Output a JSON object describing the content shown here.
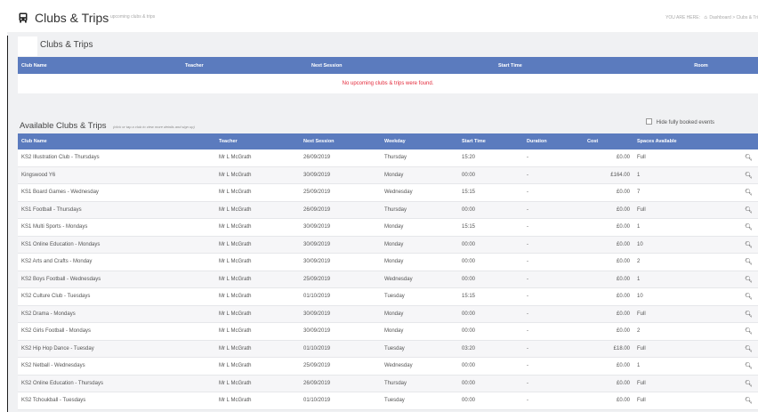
{
  "header": {
    "title": "Clubs & Trips",
    "subtitle": "upcoming clubs & trips",
    "breadcrumb": {
      "prefix": "YOU ARE HERE:",
      "home": "Dashboard",
      "separator": ">",
      "current": "Clubs & Tri"
    }
  },
  "upcoming": {
    "title": "Clubs & Trips",
    "columns": [
      "Club Name",
      "Teacher",
      "Next Session",
      "Start Time",
      "Room"
    ],
    "empty_message": "No upcoming clubs & trips were found."
  },
  "available": {
    "title": "Available Clubs & Trips",
    "hint": "(click or tap a club to view more details and sign up)",
    "hide_booked_label": "Hide fully booked events",
    "columns": [
      "Club Name",
      "Teacher",
      "Next Session",
      "Weekday",
      "Start Time",
      "Duration",
      "Cost",
      "Spaces Available"
    ],
    "rows": [
      {
        "club": "KS2 Illustration Club - Thursdays",
        "teacher": "Mr L McGrath",
        "next": "26/09/2019",
        "weekday": "Thursday",
        "start": "15:20",
        "duration": "-",
        "cost": "£0.00",
        "spaces": "Full"
      },
      {
        "club": "Kingswood Y6",
        "teacher": "Mr L McGrath",
        "next": "30/09/2019",
        "weekday": "Monday",
        "start": "00:00",
        "duration": "-",
        "cost": "£164.00",
        "spaces": "1"
      },
      {
        "club": "KS1 Board Games - Wednesday",
        "teacher": "Mr L McGrath",
        "next": "25/09/2019",
        "weekday": "Wednesday",
        "start": "15:15",
        "duration": "-",
        "cost": "£0.00",
        "spaces": "7"
      },
      {
        "club": "KS1 Football - Thursdays",
        "teacher": "Mr L McGrath",
        "next": "26/09/2019",
        "weekday": "Thursday",
        "start": "00:00",
        "duration": "-",
        "cost": "£0.00",
        "spaces": "Full"
      },
      {
        "club": "KS1 Multi Sports - Mondays",
        "teacher": "Mr L McGrath",
        "next": "30/09/2019",
        "weekday": "Monday",
        "start": "15:15",
        "duration": "-",
        "cost": "£0.00",
        "spaces": "1"
      },
      {
        "club": "KS1 Online Education - Mondays",
        "teacher": "Mr L McGrath",
        "next": "30/09/2019",
        "weekday": "Monday",
        "start": "00:00",
        "duration": "-",
        "cost": "£0.00",
        "spaces": "10"
      },
      {
        "club": "KS2 Arts and Crafts - Monday",
        "teacher": "Mr L McGrath",
        "next": "30/09/2019",
        "weekday": "Monday",
        "start": "00:00",
        "duration": "-",
        "cost": "£0.00",
        "spaces": "2"
      },
      {
        "club": "KS2 Boys Football - Wednesdays",
        "teacher": "Mr L McGrath",
        "next": "25/09/2019",
        "weekday": "Wednesday",
        "start": "00:00",
        "duration": "-",
        "cost": "£0.00",
        "spaces": "1"
      },
      {
        "club": "KS2 Culture Club - Tuesdays",
        "teacher": "Mr L McGrath",
        "next": "01/10/2019",
        "weekday": "Tuesday",
        "start": "15:15",
        "duration": "-",
        "cost": "£0.00",
        "spaces": "10"
      },
      {
        "club": "KS2 Drama - Mondays",
        "teacher": "Mr L McGrath",
        "next": "30/09/2019",
        "weekday": "Monday",
        "start": "00:00",
        "duration": "-",
        "cost": "£0.00",
        "spaces": "Full"
      },
      {
        "club": "KS2 Girls Football - Mondays",
        "teacher": "Mr L McGrath",
        "next": "30/09/2019",
        "weekday": "Monday",
        "start": "00:00",
        "duration": "-",
        "cost": "£0.00",
        "spaces": "2"
      },
      {
        "club": "KS2 Hip Hop Dance - Tuesday",
        "teacher": "Mr L McGrath",
        "next": "01/10/2019",
        "weekday": "Tuesday",
        "start": "03:20",
        "duration": "-",
        "cost": "£18.00",
        "spaces": "Full"
      },
      {
        "club": "KS2 Netball - Wednesdays",
        "teacher": "Mr L McGrath",
        "next": "25/09/2019",
        "weekday": "Wednesday",
        "start": "00:00",
        "duration": "-",
        "cost": "£0.00",
        "spaces": "1"
      },
      {
        "club": "KS2 Online Education - Thursdays",
        "teacher": "Mr L McGrath",
        "next": "26/09/2019",
        "weekday": "Thursday",
        "start": "00:00",
        "duration": "-",
        "cost": "£0.00",
        "spaces": "Full"
      },
      {
        "club": "KS2 Tchoukball - Tuesdays",
        "teacher": "Mr L McGrath",
        "next": "01/10/2019",
        "weekday": "Tuesday",
        "start": "00:00",
        "duration": "-",
        "cost": "£0.00",
        "spaces": "Full"
      }
    ]
  },
  "colors": {
    "table_header": "#5b7bbe",
    "empty_message": "#e3293a",
    "page_background": "#f0f1f3"
  },
  "icons": {
    "title": "bus-icon",
    "home": "home-icon",
    "row_action": "search-icon"
  }
}
